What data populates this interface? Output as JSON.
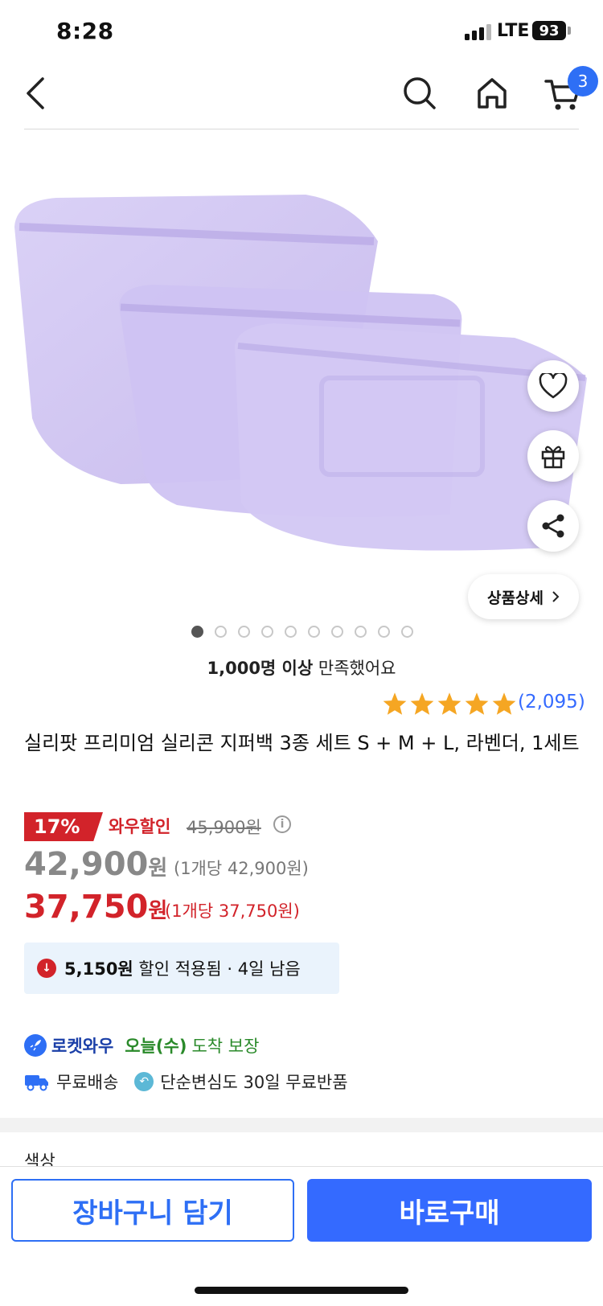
{
  "status_bar": {
    "time": "8:28",
    "network": "LTE",
    "battery": "93"
  },
  "nav": {
    "cart_count": "3"
  },
  "product": {
    "image_dots_total": 10,
    "image_dots_active": 1,
    "detail_button": "상품상세",
    "satisfied_bold": "1,000명 이상",
    "satisfied_rest": " 만족했어요",
    "stars": 5,
    "rating_count": "(2,095)",
    "title": "실리팟 프리미엄 실리콘 지퍼백 3종 세트 S + M + L, 라벤더, 1세트"
  },
  "price": {
    "discount_percent": "17%",
    "wow_label": "와우할인",
    "original_price": "45,900원",
    "sale_price": "42,900",
    "won": "원",
    "sale_unit": "(1개당 42,900원)",
    "wow_price": "37,750",
    "wow_unit": "(1개당 37,750원)"
  },
  "coupon": {
    "amount": "5,150원",
    "text": " 할인 적용됨 · 4일 남음"
  },
  "delivery": {
    "rocket_label": "로켓와우",
    "arrival_day": "오늘(수)",
    "arrival_text": "도착 보장",
    "free_shipping": "무료배송",
    "free_return": "단순변심도 30일 무료반품"
  },
  "section_cut_label": "색상",
  "bottom": {
    "cart_button": "장바구니 담기",
    "buy_button": "바로구매"
  },
  "colors": {
    "accent": "#346aff",
    "red": "#d2232a",
    "green": "#2a8a2a",
    "lavender": "#c9bdf0"
  }
}
